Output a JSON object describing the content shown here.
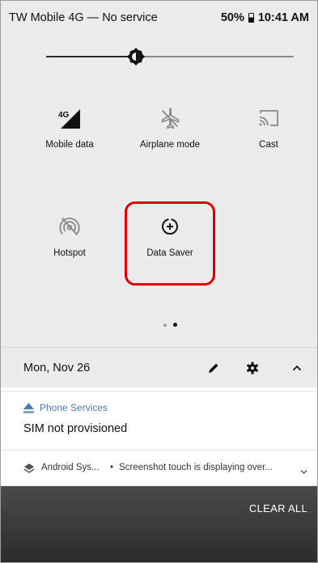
{
  "status_bar": {
    "carrier": "TW Mobile 4G — No service",
    "battery": "50%",
    "time": "10:41 AM"
  },
  "brightness": {
    "level": 0.35
  },
  "tiles": [
    {
      "label": "Mobile data",
      "icon": "signal-4g-icon",
      "network": "4G"
    },
    {
      "label": "Airplane mode",
      "icon": "airplane-off-icon"
    },
    {
      "label": "Cast",
      "icon": "cast-icon"
    },
    {
      "label": "Hotspot",
      "icon": "hotspot-off-icon"
    },
    {
      "label": "Data Saver",
      "icon": "data-saver-icon"
    }
  ],
  "page_indicator": {
    "pages": 2,
    "current": 2
  },
  "date_row": {
    "date": "Mon, Nov 26"
  },
  "notifications": [
    {
      "app": "Phone Services",
      "title": "SIM not provisioned",
      "app_color": "#4b7bb5"
    },
    {
      "app": "Android Sys...",
      "separator": "•",
      "text": "Screenshot touch is displaying over..."
    }
  ],
  "footer": {
    "clear_all": "CLEAR ALL"
  },
  "colors": {
    "highlight": "#e00000",
    "panel_bg": "#ececec",
    "footer_bg": "#333333"
  }
}
